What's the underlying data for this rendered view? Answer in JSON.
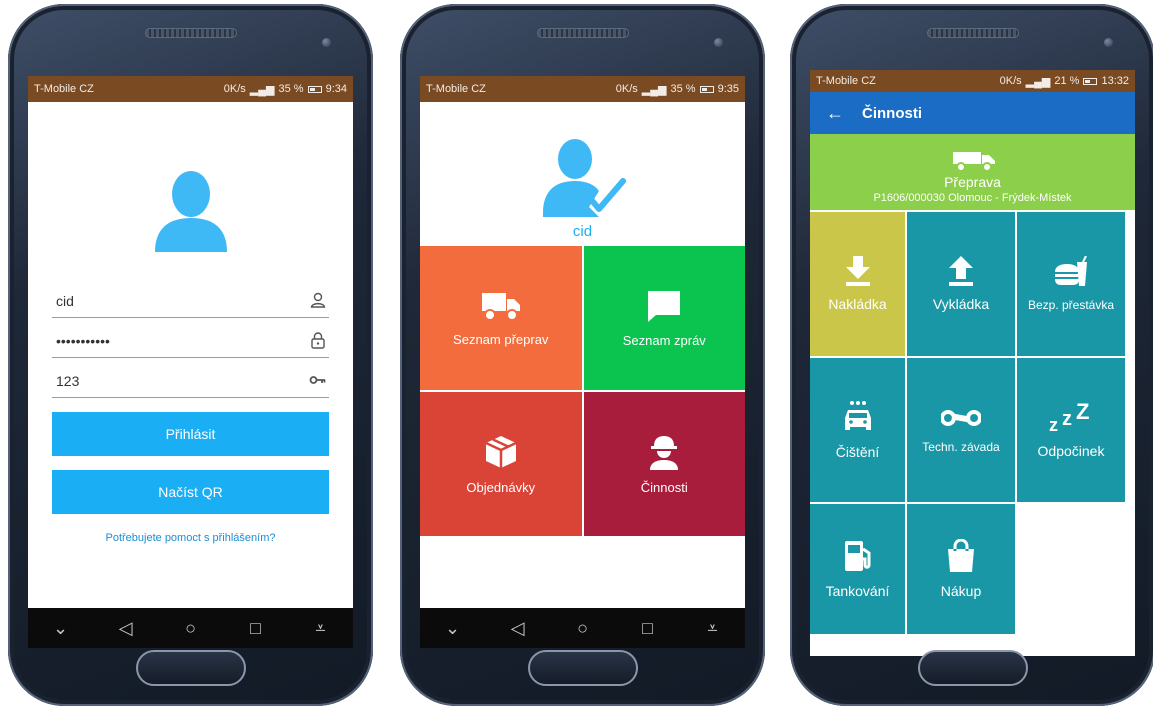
{
  "colors": {
    "status_bar": "#7a4a22",
    "primary_blue": "#1aaef5",
    "appbar_blue": "#1a6cc5",
    "tile_orange": "#f36c3e",
    "tile_green": "#0bc44f",
    "tile_red": "#d94436",
    "tile_crimson": "#a81c3c",
    "transport_green": "#8ccf4a",
    "tile_teal": "#1a97a6",
    "tile_yellow": "#c9c64a"
  },
  "screens": [
    {
      "status": {
        "carrier": "T-Mobile CZ",
        "data_rate": "0K/s",
        "battery": "35 %",
        "time": "9:34"
      },
      "login": {
        "username": "cid",
        "password": "•••••••••••",
        "pin": "123",
        "login_button": "Přihlásit",
        "qr_button": "Načíst QR",
        "help_link": "Potřebujete pomoct s přihlášením?"
      }
    },
    {
      "status": {
        "carrier": "T-Mobile CZ",
        "data_rate": "0K/s",
        "battery": "35 %",
        "time": "9:35"
      },
      "menu": {
        "user": "cid",
        "tiles": [
          {
            "label": "Seznam přeprav",
            "icon": "truck-icon"
          },
          {
            "label": "Seznam zpráv",
            "icon": "chat-bubble-icon"
          },
          {
            "label": "Objednávky",
            "icon": "package-icon"
          },
          {
            "label": "Činnosti",
            "icon": "worker-icon"
          }
        ]
      }
    },
    {
      "status": {
        "carrier": "T-Mobile CZ",
        "data_rate": "0K/s",
        "battery": "21 %",
        "time": "13:32"
      },
      "activities": {
        "title": "Činnosti",
        "transport": {
          "title": "Přeprava",
          "route": "P1606/000030 Olomouc - Frýdek-Místek"
        },
        "tiles": [
          {
            "label": "Nakládka",
            "icon": "download-icon"
          },
          {
            "label": "Vykládka",
            "icon": "upload-icon"
          },
          {
            "label": "Bezp. přestávka",
            "icon": "fast-food-icon"
          },
          {
            "label": "Čištění",
            "icon": "car-wash-icon"
          },
          {
            "label": "Techn. závada",
            "icon": "wrench-icon"
          },
          {
            "label": "Odpočinek",
            "icon": "sleep-icon"
          },
          {
            "label": "Tankování",
            "icon": "fuel-icon"
          },
          {
            "label": "Nákup",
            "icon": "shopping-bag-icon"
          }
        ]
      }
    }
  ],
  "nav_icons": [
    "chevron-down-icon",
    "back-icon",
    "home-icon",
    "recents-icon",
    "notification-pull-icon"
  ]
}
